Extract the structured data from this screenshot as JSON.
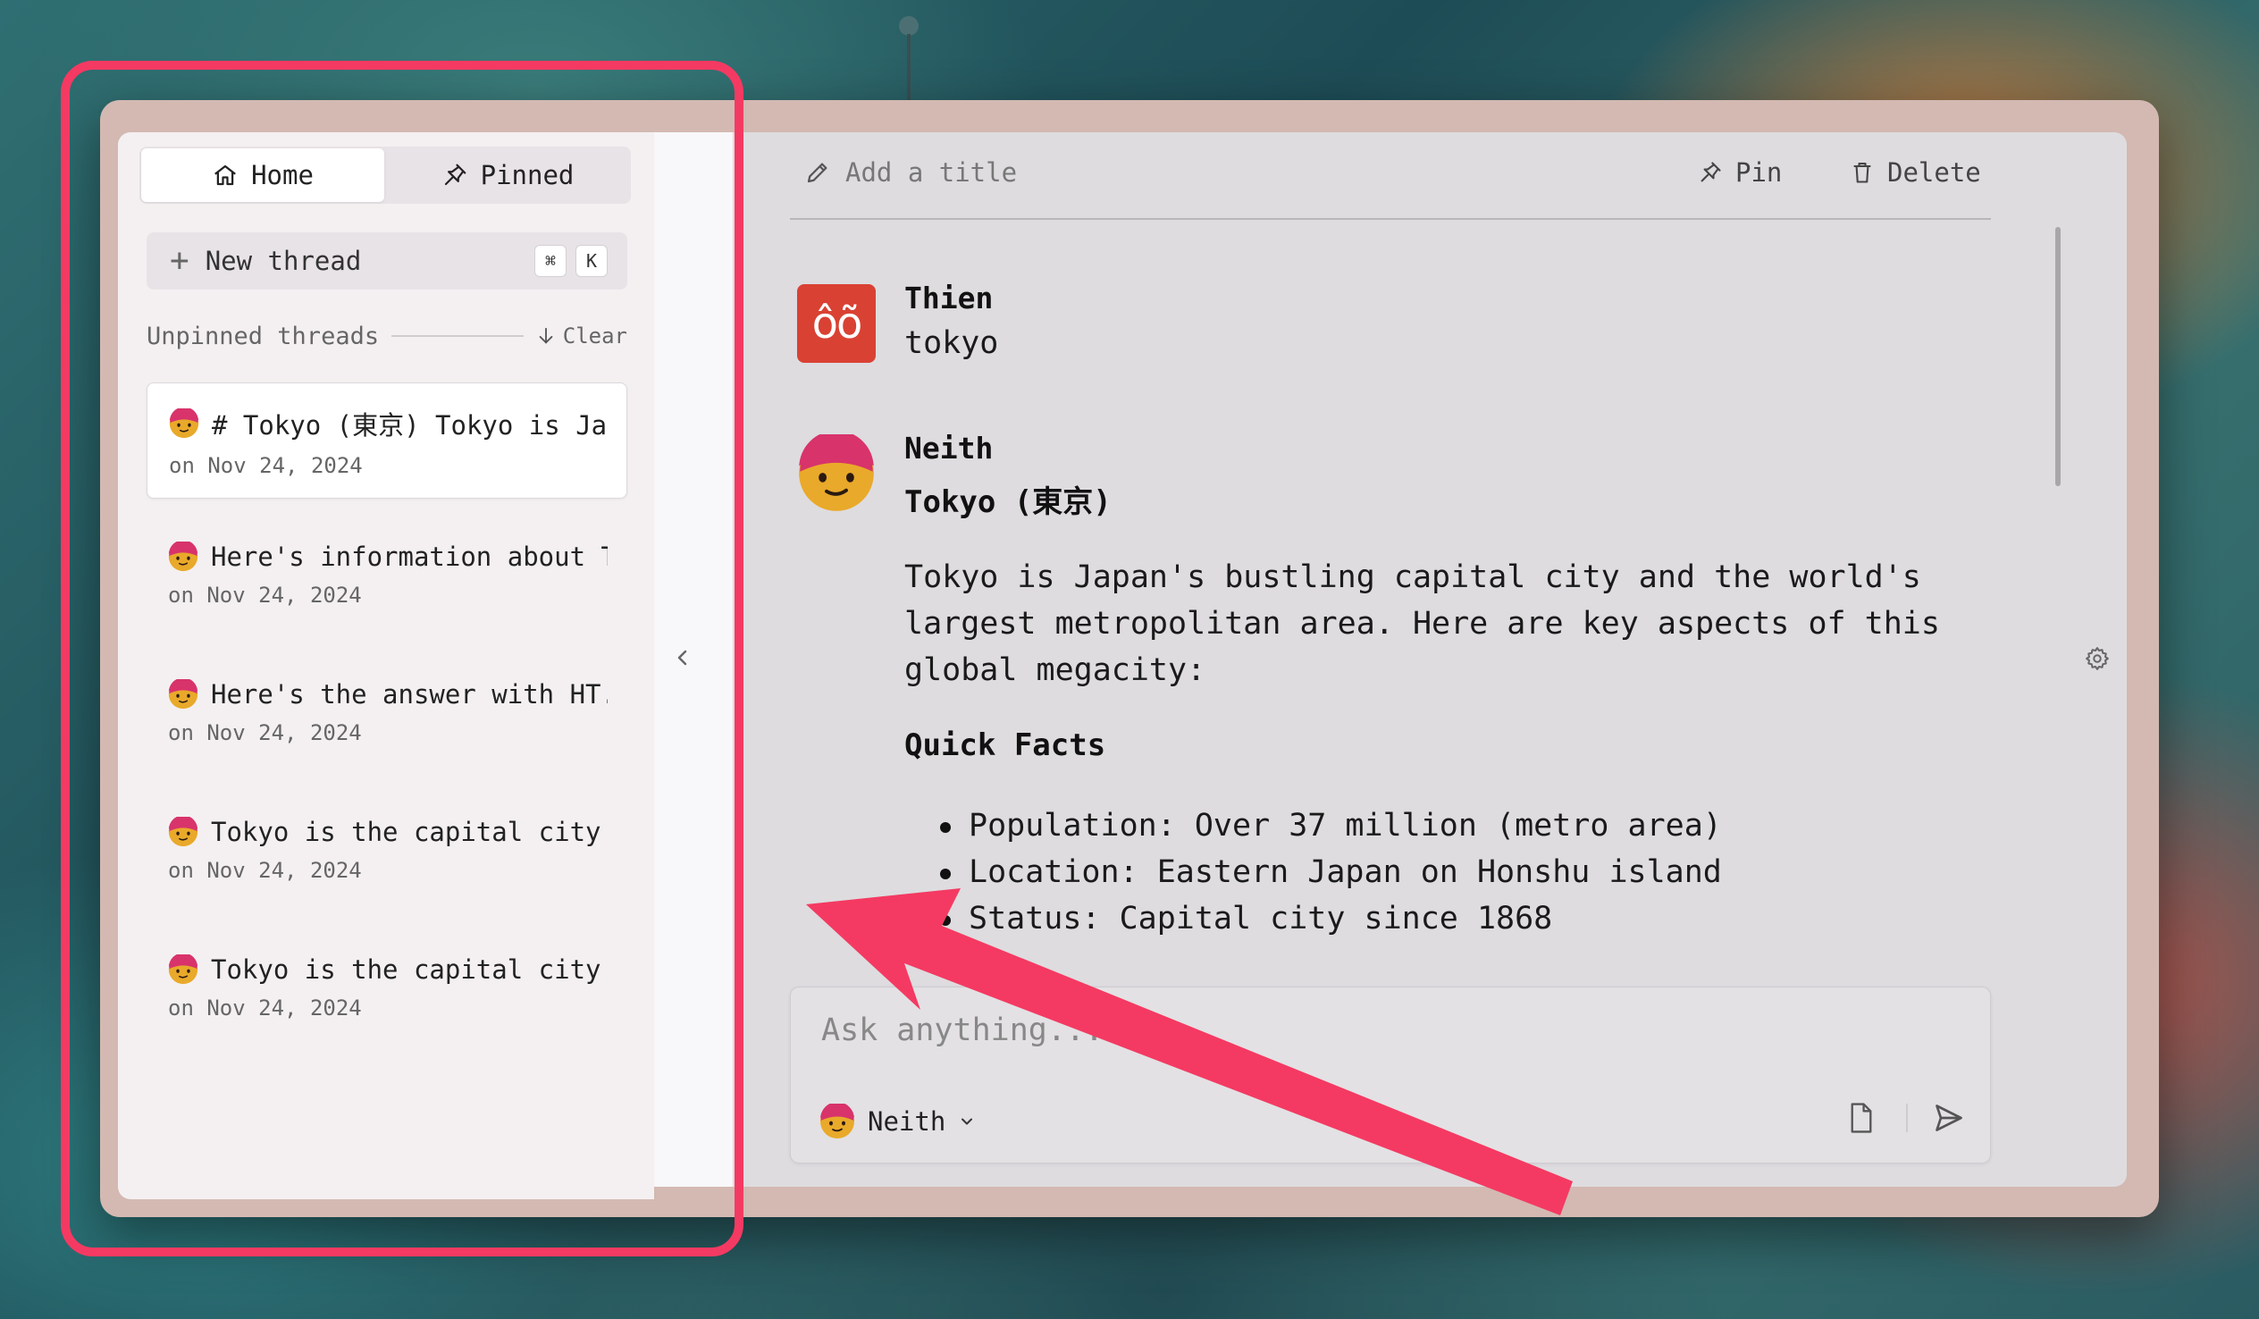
{
  "sidebar": {
    "tabs": {
      "home_label": "Home",
      "pinned_label": "Pinned"
    },
    "new_thread": {
      "label": "New thread",
      "shortcut_modifier": "⌘",
      "shortcut_key": "K"
    },
    "section_label": "Unpinned threads",
    "clear_label": "Clear",
    "threads": [
      {
        "title": "# Tokyo (東京) Tokyo is Jap...",
        "date": "on Nov 24, 2024",
        "active": true
      },
      {
        "title": "Here's information about To...",
        "date": "on Nov 24, 2024",
        "active": false
      },
      {
        "title": "Here's the answer with HT...",
        "date": "on Nov 24, 2024",
        "active": false
      },
      {
        "title": "Tokyo is the capital city of ...",
        "date": "on Nov 24, 2024",
        "active": false
      },
      {
        "title": "Tokyo is the capital city of ...",
        "date": "on Nov 24, 2024",
        "active": false
      }
    ]
  },
  "header": {
    "title_placeholder": "Add a title",
    "pin_label": "Pin",
    "delete_label": "Delete"
  },
  "messages": {
    "user": {
      "name": "Thien",
      "avatar_text": "ôõ",
      "text": "tokyo"
    },
    "assistant": {
      "name": "Neith",
      "title": "Tokyo (東京)",
      "paragraph": "Tokyo is Japan's bustling capital city and the world's largest metropolitan area. Here are key aspects of this global megacity:",
      "section_heading": "Quick Facts",
      "bullets": [
        "Population: Over 37 million (metro area)",
        "Location: Eastern Japan on Honshu island",
        "Status: Capital city since 1868"
      ]
    }
  },
  "composer": {
    "placeholder": "Ask anything...",
    "model_name": "Neith"
  },
  "icons": {
    "home": "home-icon",
    "pinned": "pin-icon",
    "new_thread": "plus-icon",
    "clear": "arrow-down-icon",
    "collapse": "chevron-left-icon",
    "title": "pencil-icon",
    "pin": "pin-icon",
    "delete": "trash-icon",
    "settings": "gear-icon",
    "attach": "file-icon",
    "send": "send-icon",
    "model_dropdown": "chevron-down-icon"
  },
  "colors": {
    "highlight": "#f43a62",
    "user_avatar": "#d94133",
    "neith_face": "#e9a92a",
    "neith_hat": "#d8336b"
  }
}
